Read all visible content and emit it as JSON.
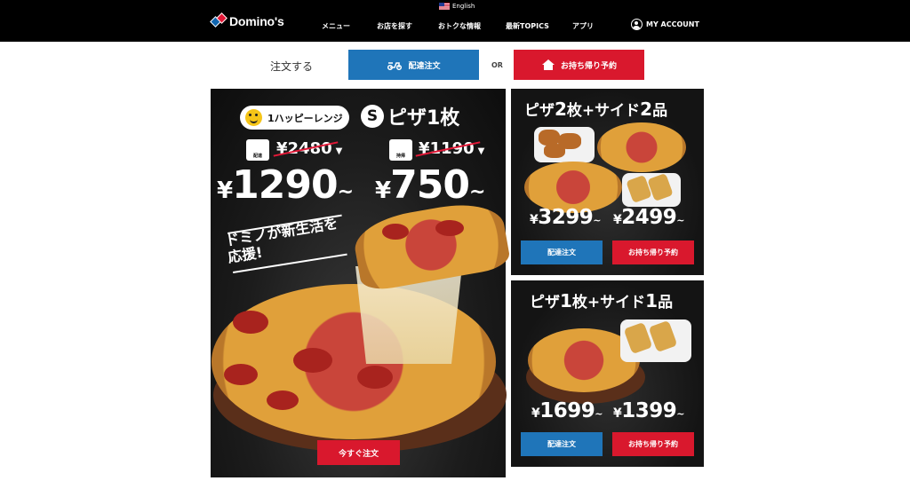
{
  "header": {
    "language": "English",
    "logo_text": "Domino's",
    "nav": [
      "メニュー",
      "お店を探す",
      "おトクな情報",
      "最新TOPICS",
      "アプリ"
    ],
    "account": "MY ACCOUNT"
  },
  "order_bar": {
    "label": "注文する",
    "delivery": "配達注文",
    "or": "OR",
    "carryout": "お持ち帰り予約"
  },
  "main_banner": {
    "pill": "1ハッピーレンジ",
    "size_badge": "S",
    "size_title": "ピザ1枚",
    "delivery_old_price": "2480",
    "carryout_old_price": "1190",
    "delivery_price": "1290",
    "carryout_price": "750",
    "yen": "¥",
    "tilde": "~",
    "slogan": "ドミノが新生活を応援!",
    "cta": "今すぐ注文"
  },
  "side_banner_1": {
    "title_a": "ピザ",
    "num_a": "2",
    "title_b": "枚+サイド",
    "num_b": "2",
    "title_c": "品",
    "delivery_price": "3299",
    "carryout_price": "2499",
    "delivery_btn": "配達注文",
    "carryout_btn": "お持ち帰り予約"
  },
  "side_banner_2": {
    "title_a": "ピザ",
    "num_a": "1",
    "title_b": "枚+サイド",
    "num_b": "1",
    "title_c": "品",
    "delivery_price": "1699",
    "carryout_price": "1399",
    "delivery_btn": "配達注文",
    "carryout_btn": "お持ち帰り予約"
  },
  "colors": {
    "header_bg": "#000000",
    "delivery_blue": "#1f75b9",
    "carryout_red": "#d9182d",
    "strike_red": "#e31837"
  }
}
